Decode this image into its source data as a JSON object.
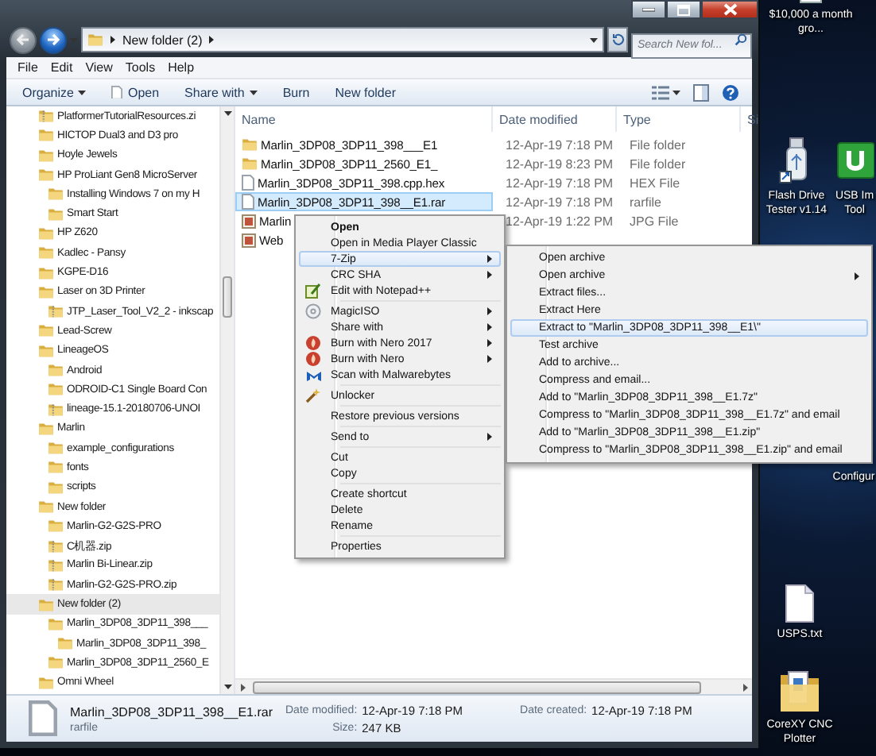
{
  "window": {
    "address": {
      "path": "New folder (2)"
    },
    "search": {
      "placeholder": "Search New fol..."
    },
    "menu_bar": [
      "File",
      "Edit",
      "View",
      "Tools",
      "Help"
    ],
    "toolbar": [
      {
        "label": "Organize",
        "dropdown": true,
        "kind": "plain"
      },
      {
        "label": "Open",
        "dropdown": false,
        "kind": "open"
      },
      {
        "label": "Share with",
        "dropdown": true,
        "kind": "plain"
      },
      {
        "label": "Burn",
        "dropdown": false,
        "kind": "plain"
      },
      {
        "label": "New folder",
        "dropdown": false,
        "kind": "plain"
      }
    ]
  },
  "navigation": {
    "items": [
      {
        "label": "PlatformerTutorialResources.zi",
        "kind": "zip",
        "selected": false
      },
      {
        "label": "HICTOP Dual3 and D3 pro",
        "kind": "folder",
        "selected": false
      },
      {
        "label": "Hoyle Jewels",
        "kind": "folder",
        "selected": false
      },
      {
        "label": "HP ProLiant Gen8 MicroServer",
        "kind": "folder",
        "selected": false,
        "children": [
          {
            "label": "Installing Windows 7 on my H",
            "kind": "folder",
            "selected": false
          },
          {
            "label": "Smart Start",
            "kind": "folder",
            "selected": false
          }
        ]
      },
      {
        "label": "HP Z620",
        "kind": "folder",
        "selected": false
      },
      {
        "label": "Kadlec - Pansy",
        "kind": "folder",
        "selected": false
      },
      {
        "label": "KGPE-D16",
        "kind": "folder",
        "selected": false
      },
      {
        "label": "Laser on 3D Printer",
        "kind": "folder",
        "selected": false,
        "children": [
          {
            "label": "JTP_Laser_Tool_V2_2 - inkscap",
            "kind": "zip",
            "selected": false
          }
        ]
      },
      {
        "label": "Lead-Screw",
        "kind": "folder",
        "selected": false
      },
      {
        "label": "LineageOS",
        "kind": "folder",
        "selected": false,
        "children": [
          {
            "label": "Android",
            "kind": "folder",
            "selected": false
          },
          {
            "label": "ODROID-C1 Single Board Con",
            "kind": "folder",
            "selected": false
          },
          {
            "label": "lineage-15.1-20180706-UNOI",
            "kind": "zip",
            "selected": false
          }
        ]
      },
      {
        "label": "Marlin",
        "kind": "folder",
        "selected": false,
        "children": [
          {
            "label": "example_configurations",
            "kind": "folder",
            "selected": false
          },
          {
            "label": "fonts",
            "kind": "folder",
            "selected": false
          },
          {
            "label": "scripts",
            "kind": "folder",
            "selected": false
          }
        ]
      },
      {
        "label": "New folder",
        "kind": "folder",
        "selected": false,
        "children": [
          {
            "label": "Marlin-G2-G2S-PRO",
            "kind": "folder",
            "selected": false
          },
          {
            "label": "C机器.zip",
            "kind": "zip",
            "selected": false
          },
          {
            "label": "Marlin Bi-Linear.zip",
            "kind": "zip",
            "selected": false
          },
          {
            "label": "Marlin-G2-G2S-PRO.zip",
            "kind": "zip",
            "selected": false
          }
        ]
      },
      {
        "label": "New folder (2)",
        "kind": "folder",
        "selected": true,
        "children": [
          {
            "label": "Marlin_3DP08_3DP11_398___",
            "kind": "folder",
            "selected": false,
            "children": [
              {
                "label": "Marlin_3DP08_3DP11_398_",
                "kind": "folder",
                "selected": false
              }
            ]
          },
          {
            "label": "Marlin_3DP08_3DP11_2560_E",
            "kind": "folder",
            "selected": false
          }
        ]
      },
      {
        "label": "Omni Wheel",
        "kind": "folder",
        "selected": false
      }
    ]
  },
  "file_list": {
    "columns": [
      "Name",
      "Date modified",
      "Type",
      "Si"
    ],
    "rows": [
      {
        "name": "Marlin_3DP08_3DP11_398___E1",
        "kind": "folder",
        "date": "12-Apr-19 7:18 PM",
        "type": "File folder",
        "selected": false
      },
      {
        "name": "Marlin_3DP08_3DP11_2560_E1_",
        "kind": "folder",
        "date": "12-Apr-19 8:23 PM",
        "type": "File folder",
        "selected": false
      },
      {
        "name": "Marlin_3DP08_3DP11_398.cpp.hex",
        "kind": "file",
        "date": "12-Apr-19 7:18 PM",
        "type": "HEX File",
        "selected": false
      },
      {
        "name": "Marlin_3DP08_3DP11_398__E1.rar",
        "kind": "file",
        "date": "12-Apr-19 7:18 PM",
        "type": "rarfile",
        "selected": true
      },
      {
        "name": "Marlin",
        "kind": "image",
        "date": "12-Apr-19 1:22 PM",
        "type": "JPG File",
        "selected": false
      },
      {
        "name": "Web",
        "kind": "image",
        "selected": false
      }
    ]
  },
  "context_menu": {
    "items": [
      {
        "kind": "default",
        "label": "Open",
        "submenu": false,
        "selected": false,
        "icon": false
      },
      {
        "kind": "item",
        "label": "Open in Media Player Classic",
        "submenu": false,
        "selected": false,
        "icon": false
      },
      {
        "kind": "item",
        "label": "7-Zip",
        "submenu": true,
        "selected": true,
        "icon": false
      },
      {
        "kind": "item",
        "label": "CRC SHA",
        "submenu": true,
        "selected": false,
        "icon": false
      },
      {
        "kind": "item",
        "label": "Edit with Notepad++",
        "submenu": false,
        "selected": false,
        "icon": true
      },
      {
        "kind": "separator"
      },
      {
        "kind": "item",
        "label": "MagicISO",
        "submenu": true,
        "selected": false,
        "icon": true
      },
      {
        "kind": "item",
        "label": "Share with",
        "submenu": true,
        "selected": false,
        "icon": false
      },
      {
        "kind": "item",
        "label": "Burn with Nero 2017",
        "submenu": true,
        "selected": false,
        "icon": true
      },
      {
        "kind": "item",
        "label": "Burn with Nero",
        "submenu": true,
        "selected": false,
        "icon": true
      },
      {
        "kind": "item",
        "label": "Scan with Malwarebytes",
        "submenu": false,
        "selected": false,
        "icon": true
      },
      {
        "kind": "separator"
      },
      {
        "kind": "item",
        "label": "Unlocker",
        "submenu": false,
        "selected": false,
        "icon": true
      },
      {
        "kind": "separator"
      },
      {
        "kind": "item",
        "label": "Restore previous versions",
        "submenu": false,
        "selected": false,
        "icon": false
      },
      {
        "kind": "separator"
      },
      {
        "kind": "item",
        "label": "Send to",
        "submenu": true,
        "selected": false,
        "icon": false
      },
      {
        "kind": "separator"
      },
      {
        "kind": "item",
        "label": "Cut",
        "submenu": false,
        "selected": false,
        "icon": false
      },
      {
        "kind": "item",
        "label": "Copy",
        "submenu": false,
        "selected": false,
        "icon": false
      },
      {
        "kind": "separator"
      },
      {
        "kind": "item",
        "label": "Create shortcut",
        "submenu": false,
        "selected": false,
        "icon": false
      },
      {
        "kind": "item",
        "label": "Delete",
        "submenu": false,
        "selected": false,
        "icon": false
      },
      {
        "kind": "item",
        "label": "Rename",
        "submenu": false,
        "selected": false,
        "icon": false
      },
      {
        "kind": "separator"
      },
      {
        "kind": "item",
        "label": "Properties",
        "submenu": false,
        "selected": false,
        "icon": false
      }
    ]
  },
  "submenu": {
    "items": [
      {
        "label": "Open archive",
        "submenu": false,
        "selected": false
      },
      {
        "label": "Open archive",
        "submenu": true,
        "selected": false
      },
      {
        "label": "Extract files...",
        "submenu": false,
        "selected": false
      },
      {
        "label": "Extract Here",
        "submenu": false,
        "selected": false
      },
      {
        "label": "Extract to \"Marlin_3DP08_3DP11_398__E1\\\"",
        "submenu": false,
        "selected": true
      },
      {
        "label": "Test archive",
        "submenu": false,
        "selected": false
      },
      {
        "label": "Add to archive...",
        "submenu": false,
        "selected": false
      },
      {
        "label": "Compress and email...",
        "submenu": false,
        "selected": false
      },
      {
        "label": "Add to \"Marlin_3DP08_3DP11_398__E1.7z\"",
        "submenu": false,
        "selected": false
      },
      {
        "label": "Compress to \"Marlin_3DP08_3DP11_398__E1.7z\" and email",
        "submenu": false,
        "selected": false
      },
      {
        "label": "Add to \"Marlin_3DP08_3DP11_398__E1.zip\"",
        "submenu": false,
        "selected": false
      },
      {
        "label": "Compress to \"Marlin_3DP08_3DP11_398__E1.zip\" and email",
        "submenu": false,
        "selected": false
      }
    ]
  },
  "details": {
    "name": "Marlin_3DP08_3DP11_398__E1.rar",
    "type": "rarfile",
    "fields": [
      {
        "label": "Date modified:",
        "value": "12-Apr-19 7:18 PM"
      },
      {
        "label": "Size:",
        "value": "247 KB"
      },
      {
        "label": "Date created:",
        "value": "12-Apr-19 7:18 PM"
      }
    ]
  },
  "desktop": {
    "icons": [
      {
        "label": "$10,000 a month gro...",
        "kind": "document"
      },
      {
        "label": "Flash Drive Tester v1.14",
        "kind": "usb-drive"
      },
      {
        "label": "USB Im Tool",
        "kind": "app"
      },
      {
        "label": "Configur",
        "kind": "none"
      },
      {
        "label": "USPS.txt",
        "kind": "text-file"
      },
      {
        "label": "CoreXY CNC Plotter",
        "kind": "folder"
      }
    ]
  }
}
